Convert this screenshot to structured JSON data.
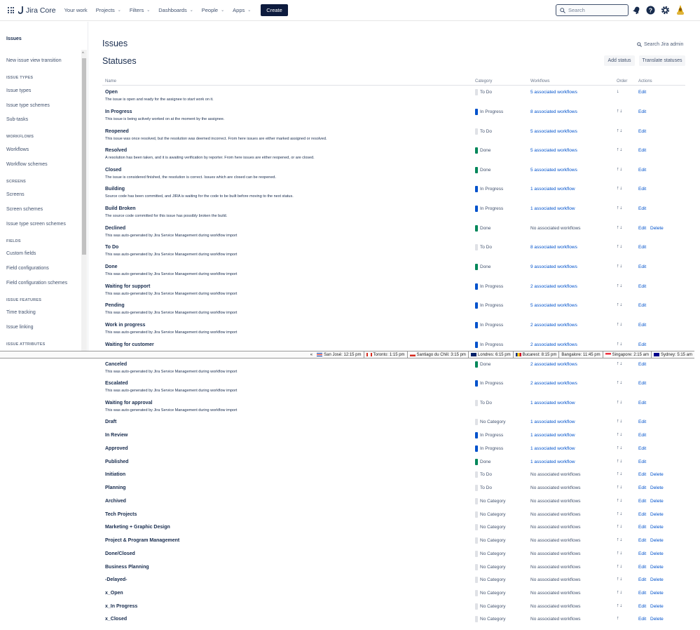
{
  "topnav": {
    "logo": "Jira Core",
    "items": [
      {
        "label": "Your work",
        "chevron": false
      },
      {
        "label": "Projects",
        "chevron": true
      },
      {
        "label": "Filters",
        "chevron": true
      },
      {
        "label": "Dashboards",
        "chevron": true
      },
      {
        "label": "People",
        "chevron": true
      },
      {
        "label": "Apps",
        "chevron": true
      }
    ],
    "create": "Create",
    "search_placeholder": "Search"
  },
  "sidebar": {
    "title": "Issues",
    "scroll_up": "^",
    "items": [
      {
        "type": "link",
        "label": "New issue view transition"
      },
      {
        "type": "head",
        "label": "ISSUE TYPES"
      },
      {
        "type": "link",
        "label": "Issue types"
      },
      {
        "type": "link",
        "label": "Issue type schemes"
      },
      {
        "type": "link",
        "label": "Sub-tasks"
      },
      {
        "type": "head",
        "label": "WORKFLOWS"
      },
      {
        "type": "link",
        "label": "Workflows"
      },
      {
        "type": "link",
        "label": "Workflow schemes"
      },
      {
        "type": "head",
        "label": "SCREENS"
      },
      {
        "type": "link",
        "label": "Screens"
      },
      {
        "type": "link",
        "label": "Screen schemes"
      },
      {
        "type": "link",
        "label": "Issue type screen schemes"
      },
      {
        "type": "head",
        "label": "FIELDS"
      },
      {
        "type": "link",
        "label": "Custom fields"
      },
      {
        "type": "link",
        "label": "Field configurations"
      },
      {
        "type": "link",
        "label": "Field configuration schemes"
      },
      {
        "type": "head",
        "label": "ISSUE FEATURES"
      },
      {
        "type": "link",
        "label": "Time tracking"
      },
      {
        "type": "link",
        "label": "Issue linking"
      },
      {
        "type": "head",
        "label": "ISSUE ATTRIBUTES"
      }
    ]
  },
  "main": {
    "title": "Issues",
    "subtitle": "Statuses",
    "search_admin": "Search Jira admin",
    "add_status": "Add status",
    "translate_statuses": "Translate statuses"
  },
  "table": {
    "headers": {
      "name": "Name",
      "category": "Category",
      "workflows": "Workflows",
      "order": "Order",
      "actions": "Actions"
    },
    "edit": "Edit",
    "delete": "Delete",
    "rows": [
      {
        "name": "Open",
        "desc": "The issue is open and ready for the assignee to start work on it.",
        "cat": "To Do",
        "color": "#dfe1e6",
        "wf": "5 associated workflows",
        "order": "↓",
        "del": false
      },
      {
        "name": "In Progress",
        "desc": "This issue is being actively worked on at the moment by the assignee.",
        "cat": "In Progress",
        "color": "#0052cc",
        "wf": "8 associated workflows",
        "order": "↑↓",
        "del": false
      },
      {
        "name": "Reopened",
        "desc": "This issue was once resolved, but the resolution was deemed incorrect. From here issues are either marked assigned or resolved.",
        "cat": "To Do",
        "color": "#dfe1e6",
        "wf": "5 associated workflows",
        "order": "↑↓",
        "del": false
      },
      {
        "name": "Resolved",
        "desc": "A resolution has been taken, and it is awaiting verification by reporter. From here issues are either reopened, or are closed.",
        "cat": "Done",
        "color": "#00875a",
        "wf": "5 associated workflows",
        "order": "↑↓",
        "del": false
      },
      {
        "name": "Closed",
        "desc": "The issue is considered finished, the resolution is correct. Issues which are closed can be reopened.",
        "cat": "Done",
        "color": "#00875a",
        "wf": "5 associated workflows",
        "order": "↑↓",
        "del": false
      },
      {
        "name": "Building",
        "desc": "Source code has been committed, and JIRA is waiting for the code to be built before moving to the next status.",
        "cat": "In Progress",
        "color": "#0052cc",
        "wf": "1 associated workflow",
        "order": "↑↓",
        "del": false
      },
      {
        "name": "Build Broken",
        "desc": "The source code committed for this issue has possibly broken the build.",
        "cat": "In Progress",
        "color": "#0052cc",
        "wf": "1 associated workflow",
        "order": "↑↓",
        "del": false
      },
      {
        "name": "Declined",
        "desc": "This was auto-generated by Jira Service Management during workflow import",
        "cat": "Done",
        "color": "#00875a",
        "wf": "No associated workflows",
        "order": "↑↓",
        "del": true
      },
      {
        "name": "To Do",
        "desc": "This was auto-generated by Jira Service Management during workflow import",
        "cat": "To Do",
        "color": "#dfe1e6",
        "wf": "8 associated workflows",
        "order": "↑↓",
        "del": false
      },
      {
        "name": "Done",
        "desc": "This was auto-generated by Jira Service Management during workflow import",
        "cat": "Done",
        "color": "#00875a",
        "wf": "9 associated workflows",
        "order": "↑↓",
        "del": false
      },
      {
        "name": "Waiting for support",
        "desc": "This was auto-generated by Jira Service Management during workflow import",
        "cat": "In Progress",
        "color": "#0052cc",
        "wf": "2 associated workflows",
        "order": "↑↓",
        "del": false
      },
      {
        "name": "Pending",
        "desc": "This was auto-generated by Jira Service Management during workflow import",
        "cat": "In Progress",
        "color": "#0052cc",
        "wf": "5 associated workflows",
        "order": "↑↓",
        "del": false
      },
      {
        "name": "Work in progress",
        "desc": "This was auto-generated by Jira Service Management during workflow import",
        "cat": "In Progress",
        "color": "#0052cc",
        "wf": "2 associated workflows",
        "order": "↑↓",
        "del": false
      },
      {
        "name": "Waiting for customer",
        "desc": "",
        "cat": "In Progress",
        "color": "#0052cc",
        "wf": "2 associated workflows",
        "order": "↑↓",
        "del": false
      },
      {
        "name": "Canceled",
        "desc": "This was auto-generated by Jira Service Management during workflow import",
        "cat": "Done",
        "color": "#00875a",
        "wf": "2 associated workflows",
        "order": "↑↓",
        "del": false
      },
      {
        "name": "Escalated",
        "desc": "This was auto-generated by Jira Service Management during workflow import",
        "cat": "In Progress",
        "color": "#0052cc",
        "wf": "2 associated workflows",
        "order": "↑↓",
        "del": false
      },
      {
        "name": "Waiting for approval",
        "desc": "This was auto-generated by Jira Service Management during workflow import",
        "cat": "To Do",
        "color": "#dfe1e6",
        "wf": "1 associated workflow",
        "order": "↑↓",
        "del": false
      },
      {
        "name": "Draft",
        "desc": "",
        "cat": "No Category",
        "color": "#dfe1e6",
        "wf": "1 associated workflow",
        "order": "↑↓",
        "del": false
      },
      {
        "name": "In Review",
        "desc": "",
        "cat": "In Progress",
        "color": "#0052cc",
        "wf": "1 associated workflow",
        "order": "↑↓",
        "del": false
      },
      {
        "name": "Approved",
        "desc": "",
        "cat": "In Progress",
        "color": "#0052cc",
        "wf": "1 associated workflow",
        "order": "↑↓",
        "del": false
      },
      {
        "name": "Published",
        "desc": "",
        "cat": "Done",
        "color": "#00875a",
        "wf": "1 associated workflow",
        "order": "↑↓",
        "del": false
      },
      {
        "name": "Initiation",
        "desc": "",
        "cat": "To Do",
        "color": "#dfe1e6",
        "wf": "No associated workflows",
        "order": "↑↓",
        "del": true
      },
      {
        "name": "Planning",
        "desc": "",
        "cat": "To Do",
        "color": "#dfe1e6",
        "wf": "No associated workflows",
        "order": "↑↓",
        "del": true
      },
      {
        "name": "Archived",
        "desc": "",
        "cat": "No Category",
        "color": "#dfe1e6",
        "wf": "No associated workflows",
        "order": "↑↓",
        "del": true
      },
      {
        "name": "Tech Projects",
        "desc": "",
        "cat": "No Category",
        "color": "#dfe1e6",
        "wf": "No associated workflows",
        "order": "↑↓",
        "del": true
      },
      {
        "name": "Marketing + Graphic Design",
        "desc": "",
        "cat": "No Category",
        "color": "#dfe1e6",
        "wf": "No associated workflows",
        "order": "↑↓",
        "del": true
      },
      {
        "name": "Project & Program Management",
        "desc": "",
        "cat": "No Category",
        "color": "#dfe1e6",
        "wf": "No associated workflows",
        "order": "↑↓",
        "del": true
      },
      {
        "name": "Done/Closed",
        "desc": "",
        "cat": "No Category",
        "color": "#dfe1e6",
        "wf": "No associated workflows",
        "order": "↑↓",
        "del": true
      },
      {
        "name": "Business Planning",
        "desc": "",
        "cat": "No Category",
        "color": "#dfe1e6",
        "wf": "No associated workflows",
        "order": "↑↓",
        "del": true
      },
      {
        "name": "-Delayed-",
        "desc": "",
        "cat": "No Category",
        "color": "#dfe1e6",
        "wf": "No associated workflows",
        "order": "↑↓",
        "del": true
      },
      {
        "name": "x_Open",
        "desc": "",
        "cat": "No Category",
        "color": "#dfe1e6",
        "wf": "No associated workflows",
        "order": "↑↓",
        "del": true
      },
      {
        "name": "x_In Progress",
        "desc": "",
        "cat": "No Category",
        "color": "#dfe1e6",
        "wf": "No associated workflows",
        "order": "↑↓",
        "del": true
      },
      {
        "name": "x_Closed",
        "desc": "",
        "cat": "No Category",
        "color": "#dfe1e6",
        "wf": "No associated workflows",
        "order": "↑",
        "del": true
      }
    ]
  },
  "timezones": {
    "arrow": "«",
    "items": [
      {
        "label": "San José: 12:15 pm",
        "flag": "cr"
      },
      {
        "label": "Toronto: 1:15 pm",
        "flag": "ca"
      },
      {
        "label": "Santiago du Chili: 3:15 pm",
        "flag": "cl"
      },
      {
        "label": "Londres: 6:15 pm",
        "flag": "gb"
      },
      {
        "label": "Bucarest: 8:15 pm",
        "flag": "ro"
      },
      {
        "label": "Bangalore: 11:45 pm",
        "flag": ""
      },
      {
        "label": "Singapore: 2:15 am",
        "flag": "sg"
      },
      {
        "label": "Sydney: 5:15 am",
        "flag": "au"
      }
    ]
  }
}
